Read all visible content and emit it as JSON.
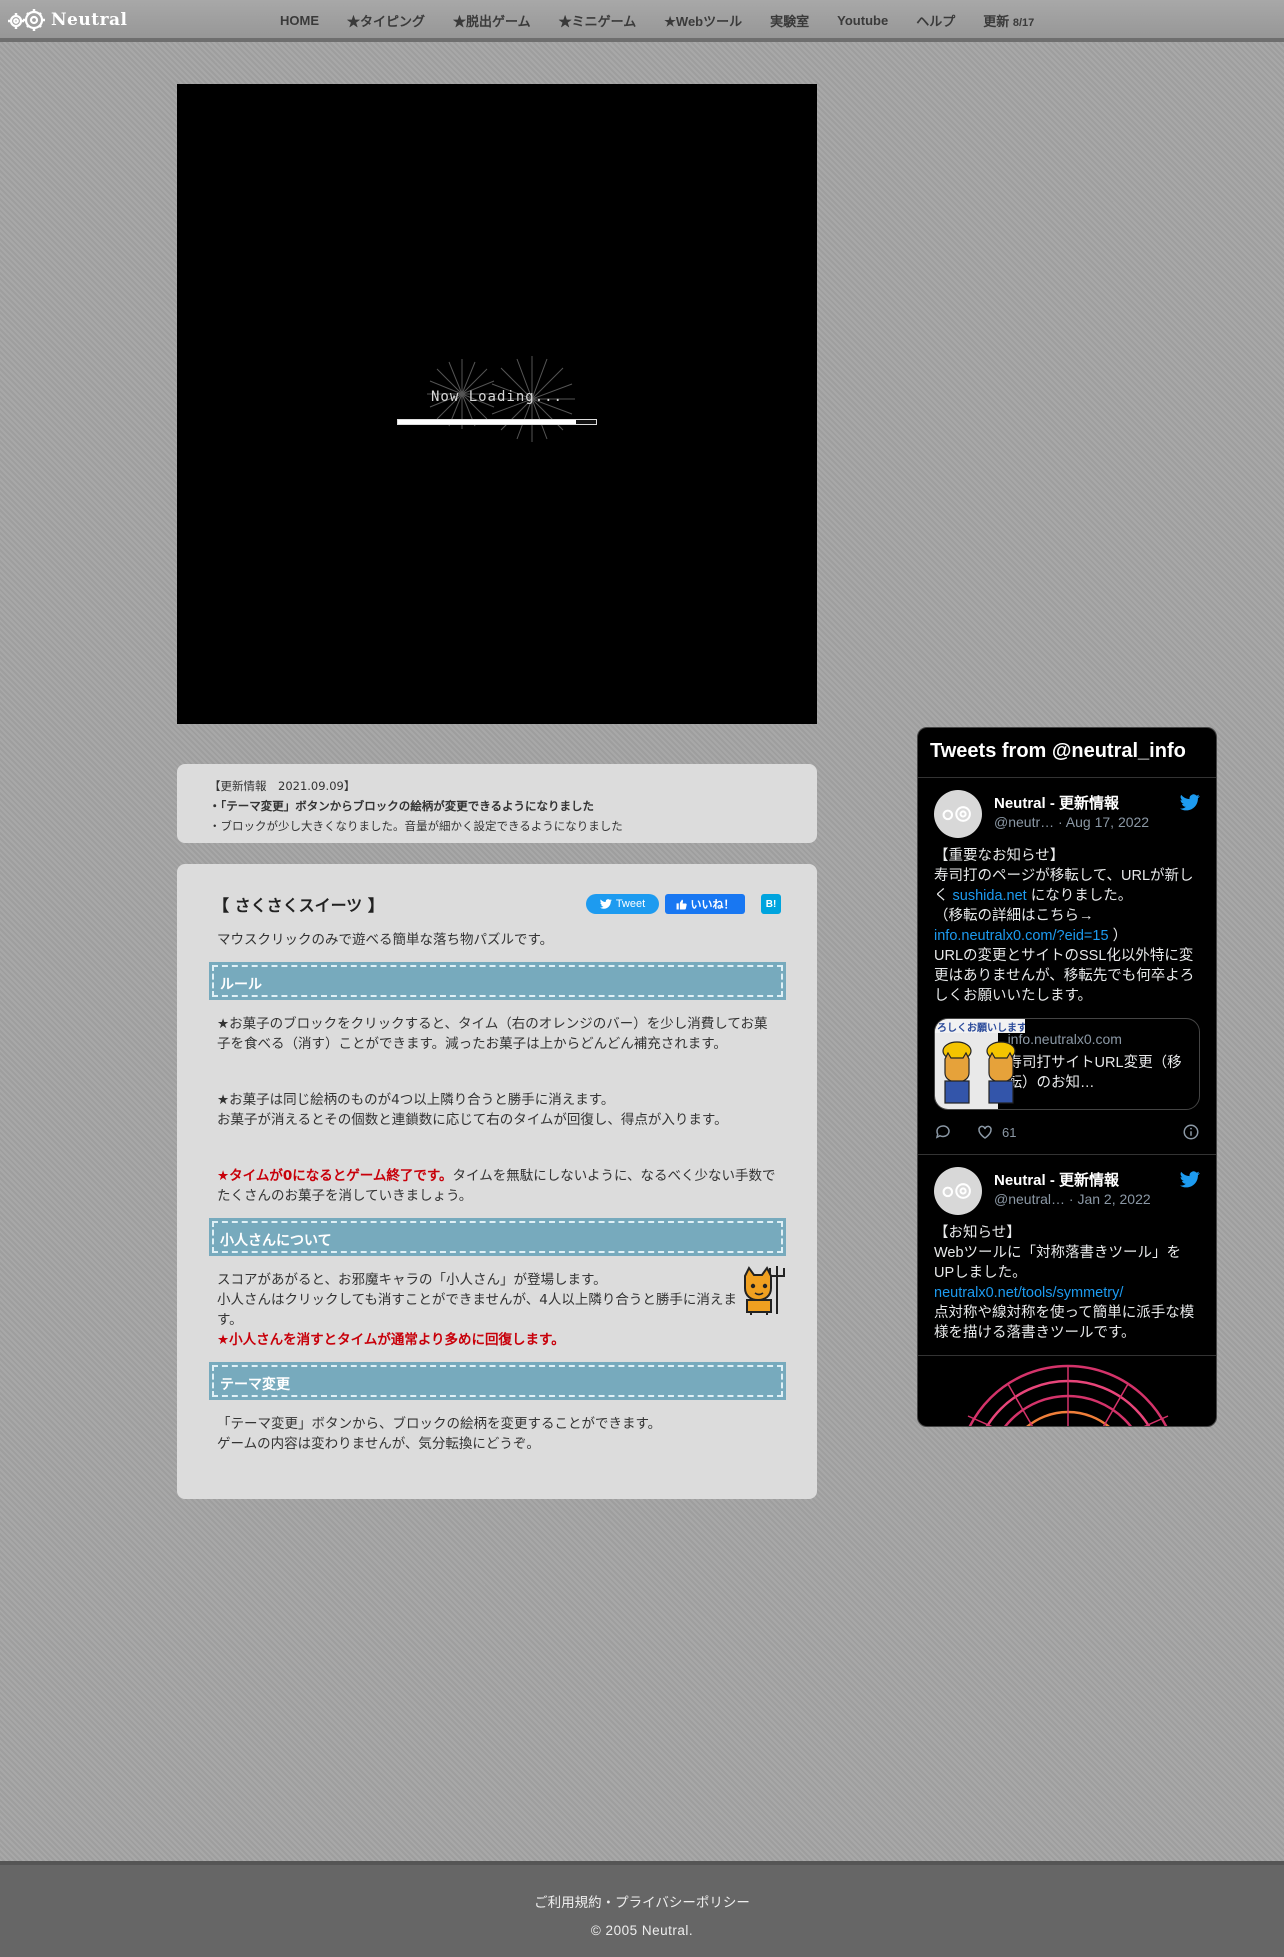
{
  "header": {
    "logo_text": "Neutral",
    "nav": [
      {
        "label": "HOME"
      },
      {
        "label": "★タイピング"
      },
      {
        "label": "★脱出ゲーム"
      },
      {
        "label": "★ミニゲーム"
      },
      {
        "label": "★Webツール"
      },
      {
        "label": "実験室"
      },
      {
        "label": "Youtube"
      },
      {
        "label": "ヘルプ"
      }
    ],
    "update_label": "更新",
    "update_date": "8/17"
  },
  "game": {
    "loading_text": "Now Loading...",
    "progress": 0.9
  },
  "updates": {
    "heading": "【更新情報　2021.09.09】",
    "item1": "・「テーマ変更」ボタンからブロックの絵柄が変更できるようになりました",
    "item2": "・ブロックが少し大きくなりました。音量が細かく設定できるようになりました"
  },
  "article": {
    "title": "【 さくさくスイーツ 】",
    "share": {
      "tweet": "Tweet",
      "like": "いいね！",
      "hatena": "B!"
    },
    "intro": "マウスクリックのみで遊べる簡単な落ち物パズルです。",
    "section_rules": "ルール",
    "rules_p1": "★お菓子のブロックをクリックすると、タイム（右のオレンジのバー）を少し消費してお菓子を食べる（消す）ことができます。減ったお菓子は上からどんどん補充されます。",
    "rules_p2_line1": "★お菓子は同じ絵柄のものが4つ以上隣り合うと勝手に消えます。",
    "rules_p2_line2": "お菓子が消えるとその個数と連鎖数に応じて右のタイムが回復し、得点が入ります。",
    "rules_p3_red": "★タイムが0になるとゲーム終了です。",
    "rules_p3_rest": "タイムを無駄にしないように、なるべく少ない手数でたくさんのお菓子を消していきましょう。",
    "section_kobito": "小人さんについて",
    "kobito_line1": "スコアがあがると、お邪魔キャラの「小人さん」が登場します。",
    "kobito_line2": "小人さんはクリックしても消すことができませんが、4人以上隣り合うと勝手に消えます。",
    "kobito_red": "★小人さんを消すとタイムが通常より多めに回復します。",
    "section_theme": "テーマ変更",
    "theme_line1": "「テーマ変更」ボタンから、ブロックの絵柄を変更することができます。",
    "theme_line2": "ゲームの内容は変わりませんが、気分転換にどうぞ。"
  },
  "twitter": {
    "header": "Tweets from @neutral_info",
    "tweets": [
      {
        "name": "Neutral - 更新情報",
        "handle": "@neutr…",
        "date": "· Aug 17, 2022",
        "line1": "【重要なお知らせ】",
        "line2a": "寿司打のページが移転して、URLが新しく",
        "link1": "sushida.net",
        "line2b": "になりました。",
        "line3": "（移転の詳細はこちら→",
        "link2": "info.neutralx0.com/?eid=15",
        "line3b": "）",
        "line4": "URLの変更とサイトのSSL化以外特に変更はありませんが、移転先でも何卒よろしくお願いいたします。",
        "card_banner": "ろしくお願いします",
        "card_domain": "info.neutralx0.com",
        "card_title": "寿司打サイトURL変更（移転）のお知…",
        "likes": "61"
      },
      {
        "name": "Neutral - 更新情報",
        "handle": "@neutral…",
        "date": "· Jan 2, 2022",
        "line1": "【お知らせ】",
        "line2": "Webツールに「対称落書きツール」をUPしました。",
        "link1": "neutralx0.net/tools/symmetry/",
        "line3": "点対称や線対称を使って簡単に派手な模様を描ける落書きツールです。"
      }
    ]
  },
  "footer": {
    "links": "ご利用規約・プライバシーポリシー",
    "copyright": "© 2005 Neutral."
  },
  "colors": {
    "section_head": "#77aabd",
    "accent_red": "#c8000a",
    "twitter_blue": "#1d9bf0"
  }
}
